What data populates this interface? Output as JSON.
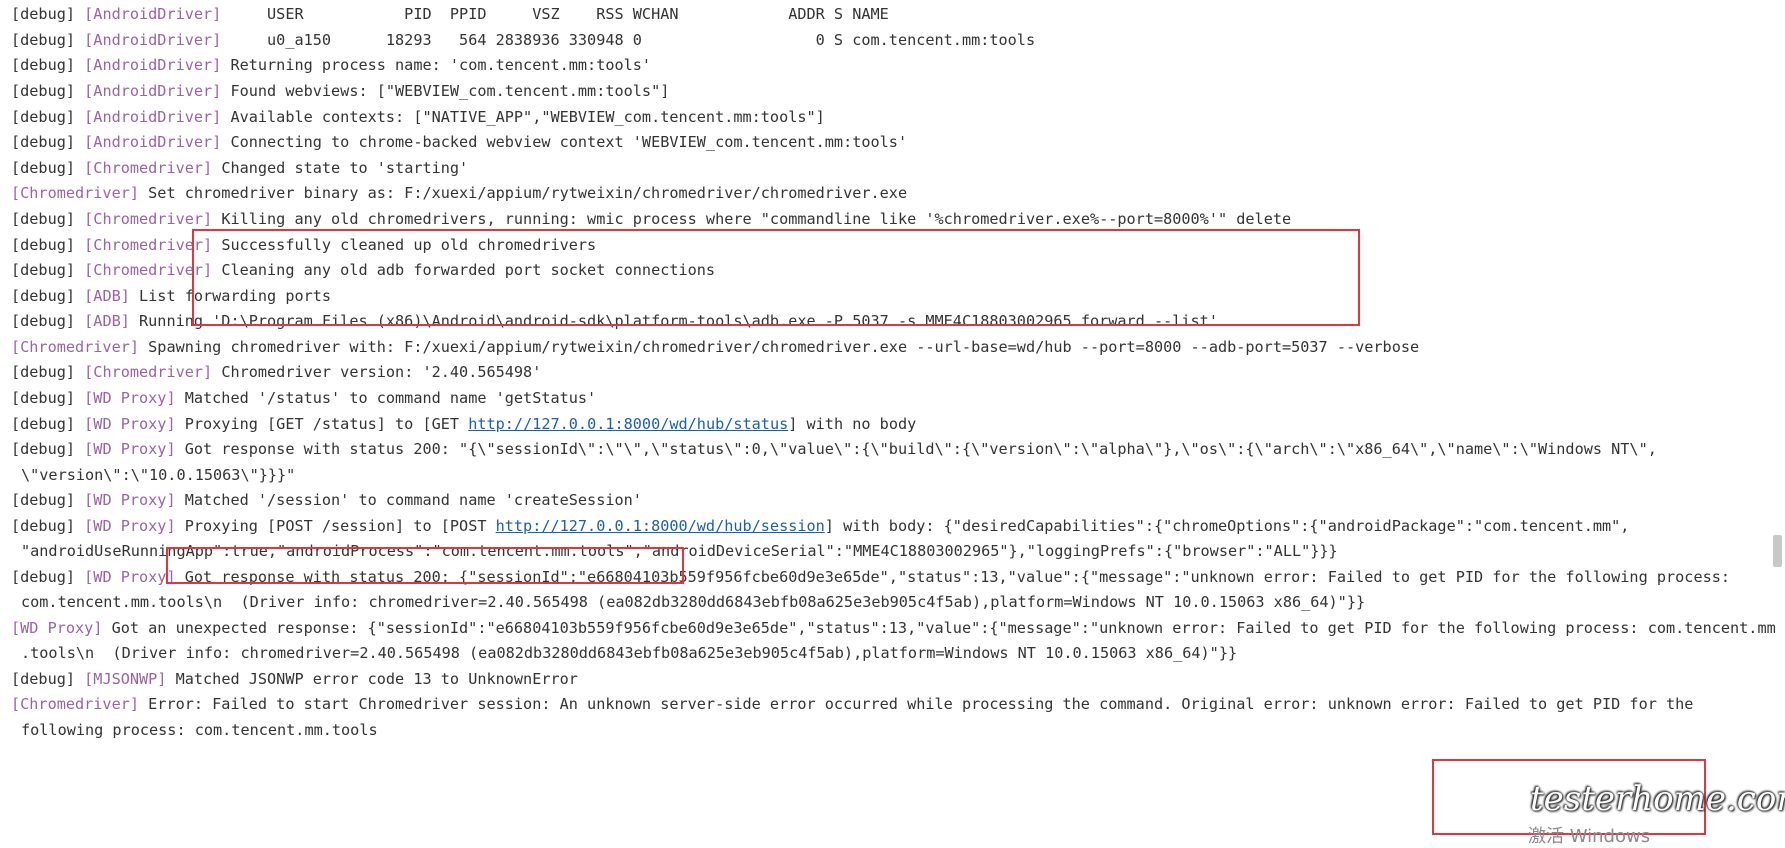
{
  "console": {
    "lines": [
      [
        {
          "t": "[debug] "
        },
        {
          "t": "[AndroidDriver]",
          "c": "tag"
        },
        {
          "t": "     USER           PID  PPID     VSZ    RSS WCHAN            ADDR S NAME"
        }
      ],
      [
        {
          "t": "[debug] "
        },
        {
          "t": "[AndroidDriver]",
          "c": "tag"
        },
        {
          "t": "     u0_a150      18293   564 2838936 330948 0                   0 S com.tencent.mm:tools"
        }
      ],
      [
        {
          "t": "[debug] "
        },
        {
          "t": "[AndroidDriver]",
          "c": "tag"
        },
        {
          "t": " Returning process name: 'com.tencent.mm:tools'"
        }
      ],
      [
        {
          "t": "[debug] "
        },
        {
          "t": "[AndroidDriver]",
          "c": "tag"
        },
        {
          "t": " Found webviews: [\"WEBVIEW_com.tencent.mm:tools\"]"
        }
      ],
      [
        {
          "t": "[debug] "
        },
        {
          "t": "[AndroidDriver]",
          "c": "tag"
        },
        {
          "t": " Available contexts: [\"NATIVE_APP\",\"WEBVIEW_com.tencent.mm:tools\"]"
        }
      ],
      [
        {
          "t": "[debug] "
        },
        {
          "t": "[AndroidDriver]",
          "c": "tag"
        },
        {
          "t": " Connecting to chrome-backed webview context 'WEBVIEW_com.tencent.mm:tools'"
        }
      ],
      [
        {
          "t": "[debug] "
        },
        {
          "t": "[Chromedriver]",
          "c": "tag"
        },
        {
          "t": " Changed state to 'starting'"
        }
      ],
      [
        {
          "t": "[Chromedriver]",
          "c": "tag"
        },
        {
          "t": " Set chromedriver binary as: F:/xuexi/appium/rytweixin/chromedriver/chromedriver.exe"
        }
      ],
      [
        {
          "t": "[debug] "
        },
        {
          "t": "[Chromedriver]",
          "c": "tag"
        },
        {
          "t": " Killing any old chromedrivers, running: wmic process where \"commandline like '%chromedriver.exe%--port=8000%'\" delete"
        }
      ],
      [
        {
          "t": "[debug] "
        },
        {
          "t": "[Chromedriver]",
          "c": "tag"
        },
        {
          "t": " Successfully cleaned up old chromedrivers"
        }
      ],
      [
        {
          "t": "[debug] "
        },
        {
          "t": "[Chromedriver]",
          "c": "tag"
        },
        {
          "t": " Cleaning any old adb forwarded port socket connections"
        }
      ],
      [
        {
          "t": "[debug] "
        },
        {
          "t": "[ADB]",
          "c": "tag"
        },
        {
          "t": " List forwarding ports"
        }
      ],
      [
        {
          "t": "[debug] "
        },
        {
          "t": "[ADB]",
          "c": "tag"
        },
        {
          "t": " Running 'D:\\Program Files (x86)\\Android\\android-sdk\\platform-tools\\adb.exe -P 5037 -s MME4C18803002965 forward --list'"
        }
      ],
      [
        {
          "t": "[Chromedriver]",
          "c": "tag"
        },
        {
          "t": " Spawning chromedriver with: F:/xuexi/appium/rytweixin/chromedriver/chromedriver.exe --url-base=wd/hub --port=8000 --adb-port=5037 --verbose"
        }
      ],
      [
        {
          "t": "[debug] "
        },
        {
          "t": "[Chromedriver]",
          "c": "tag"
        },
        {
          "t": " Chromedriver version: '2.40.565498'"
        }
      ],
      [
        {
          "t": "[debug] "
        },
        {
          "t": "[WD Proxy]",
          "c": "tag"
        },
        {
          "t": " Matched '/status' to command name 'getStatus'"
        }
      ],
      [
        {
          "t": "[debug] "
        },
        {
          "t": "[WD Proxy]",
          "c": "tag"
        },
        {
          "t": " Proxying [GET /status] to [GET "
        },
        {
          "t": "http://127.0.0.1:8000/wd/hub/status",
          "c": "lnk"
        },
        {
          "t": "] with no body"
        }
      ],
      [
        {
          "t": "[debug] "
        },
        {
          "t": "[WD Proxy]",
          "c": "tag"
        },
        {
          "t": " Got response with status 200: \"{\\\"sessionId\\\":\\\"\\\",\\\"status\\\":0,\\\"value\\\":{\\\"build\\\":{\\\"version\\\":\\\"alpha\\\"},\\\"os\\\":{\\\"arch\\\":\\\"x86_64\\\",\\\"name\\\":\\\"Windows NT\\\","
        }
      ],
      [
        {
          "t": "\\\"version\\\":\\\"10.0.15063\\\"}}}\""
        }
      ],
      [
        {
          "t": "[debug] "
        },
        {
          "t": "[WD Proxy]",
          "c": "tag"
        },
        {
          "t": " Matched '/session' to command name 'createSession'"
        }
      ],
      [
        {
          "t": "[debug] "
        },
        {
          "t": "[WD Proxy]",
          "c": "tag"
        },
        {
          "t": " Proxying [POST /session] to [POST "
        },
        {
          "t": "http://127.0.0.1:8000/wd/hub/session",
          "c": "lnk"
        },
        {
          "t": "] with body: {\"desiredCapabilities\":{\"chromeOptions\":{\"androidPackage\":\"com.tencent.mm\","
        }
      ],
      [
        {
          "t": "\"androidUseRunningApp\":true,\"androidProcess\":\"com.tencent.mm.tools\",\"androidDeviceSerial\":\"MME4C18803002965\"},\"loggingPrefs\":{\"browser\":\"ALL\"}}}"
        }
      ],
      [
        {
          "t": "[debug] "
        },
        {
          "t": "[WD Proxy]",
          "c": "tag"
        },
        {
          "t": " Got response with status 200: {\"sessionId\":\"e66804103b559f956fcbe60d9e3e65de\",\"status\":13,\"value\":{\"message\":\"unknown error: Failed to get PID for the following process:"
        }
      ],
      [
        {
          "t": "com.tencent.mm.tools\\n  (Driver info: chromedriver=2.40.565498 (ea082db3280dd6843ebfb08a625e3eb905c4f5ab),platform=Windows NT 10.0.15063 x86_64)\"}}"
        }
      ],
      [
        {
          "t": "[WD Proxy]",
          "c": "tag"
        },
        {
          "t": " Got an unexpected response: {\"sessionId\":\"e66804103b559f956fcbe60d9e3e65de\",\"status\":13,\"value\":{\"message\":\"unknown error: Failed to get PID for the following process: com.tencent.mm"
        }
      ],
      [
        {
          "t": ".tools\\n  (Driver info: chromedriver=2.40.565498 (ea082db3280dd6843ebfb08a625e3eb905c4f5ab),platform=Windows NT 10.0.15063 x86_64)\"}}"
        }
      ],
      [
        {
          "t": "[debug] "
        },
        {
          "t": "[MJSONWP]",
          "c": "tag"
        },
        {
          "t": " Matched JSONWP error code 13 to UnknownError"
        }
      ],
      [
        {
          "t": "[Chromedriver]",
          "c": "tag"
        },
        {
          "t": " Error: Failed to start Chromedriver session: An unknown server-side error occurred while processing the command. Original error: unknown error: Failed to get PID for the"
        }
      ],
      [
        {
          "t": "following process: com.tencent.mm.tools"
        }
      ]
    ]
  },
  "watermark": {
    "brand": "testerhome.com",
    "os_text": "激活 Windows"
  },
  "colors": {
    "tag": "#9b62a6",
    "text": "#333333",
    "link": "#1a5fb4",
    "highlight": "#e2353f",
    "background": "#ffffff"
  }
}
